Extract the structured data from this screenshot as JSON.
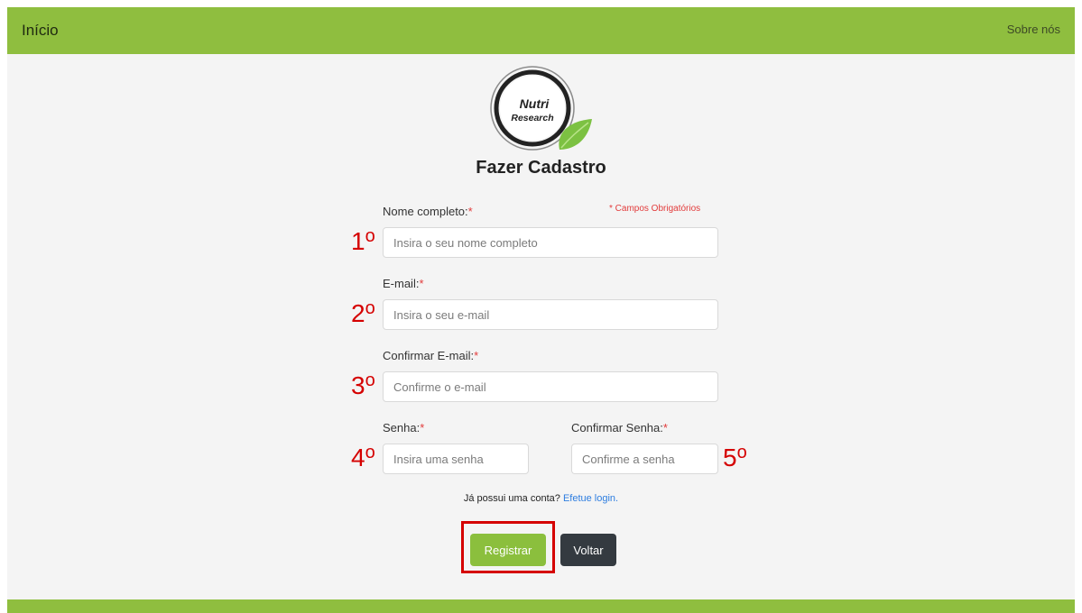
{
  "nav": {
    "brand": "Início",
    "about": "Sobre nós"
  },
  "logo": {
    "line1": "Nutri",
    "line2": "Research"
  },
  "form": {
    "title": "Fazer Cadastro",
    "required_note": "* Campos Obrigatórios",
    "required_mark": "*",
    "fields": [
      {
        "label": "Nome completo:",
        "placeholder": "Insira o seu nome completo",
        "value": "",
        "step": "1"
      },
      {
        "label": "E-mail:",
        "placeholder": "Insira o seu e-mail",
        "value": "",
        "step": "2"
      },
      {
        "label": "Confirmar E-mail:",
        "placeholder": "Confirme o e-mail",
        "value": "",
        "step": "3"
      },
      {
        "label": "Senha:",
        "placeholder": "Insira uma senha",
        "value": "",
        "step": "4"
      },
      {
        "label": "Confirmar Senha:",
        "placeholder": "Confirme a senha",
        "value": "",
        "step": "5"
      }
    ],
    "step_suffix": "o",
    "login_prompt": "Já possui uma conta?",
    "login_link": "Efetue login.",
    "register_button": "Registrar",
    "back_button": "Voltar"
  },
  "colors": {
    "brand_green": "#8fbe3f",
    "annotation_red": "#d50000",
    "link_blue": "#2d7de0",
    "dark_button": "#343a40"
  }
}
